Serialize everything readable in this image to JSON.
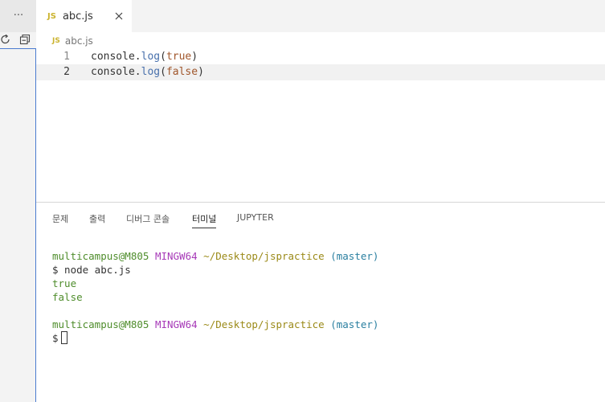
{
  "sidebar": {
    "more_label": "···",
    "refresh_icon": "refresh-icon",
    "collapse_icon": "collapse-all-icon"
  },
  "tabs": [
    {
      "badge": "JS",
      "label": "abc.js",
      "active": true
    }
  ],
  "breadcrumb": {
    "badge": "JS",
    "file": "abc.js"
  },
  "editor": {
    "lines": [
      {
        "num": "1",
        "obj": "console",
        "dot": ".",
        "fn": "log",
        "open": "(",
        "arg": "true",
        "close": ")"
      },
      {
        "num": "2",
        "obj": "console",
        "dot": ".",
        "fn": "log",
        "open": "(",
        "arg": "false",
        "close": ")"
      }
    ]
  },
  "panel": {
    "tabs": [
      "문제",
      "출력",
      "디버그 콘솔",
      "터미널",
      "JUPYTER"
    ],
    "active_tab": "터미널"
  },
  "terminal": {
    "prompt1": {
      "user": "multicampus@M805",
      "env": "MINGW64",
      "path": "~/Desktop/jspractice",
      "branch": "(master)"
    },
    "command": "$ node abc.js",
    "output": [
      "true",
      "false"
    ],
    "prompt2": {
      "user": "multicampus@M805",
      "env": "MINGW64",
      "path": "~/Desktop/jspractice",
      "branch": "(master)"
    },
    "input_prompt": "$"
  },
  "colors": {
    "accent_border": "#4a7bd0",
    "js_badge": "#cbb32e",
    "term_user": "#4f8d2c",
    "term_env": "#a73ab8",
    "term_path": "#9b8a18",
    "term_branch": "#2a7fa0"
  }
}
